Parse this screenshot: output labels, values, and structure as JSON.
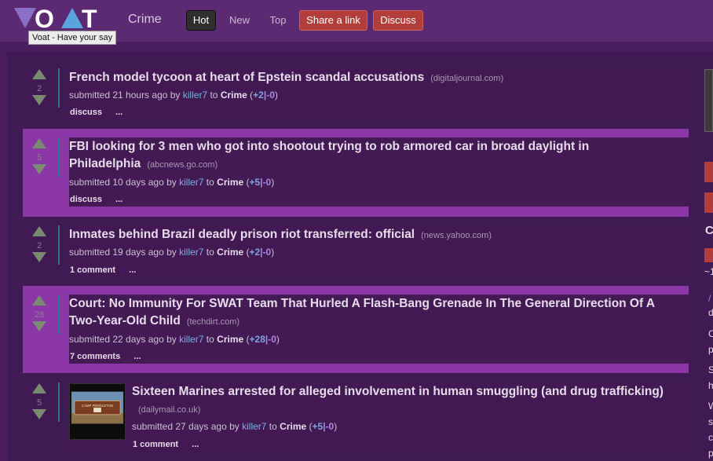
{
  "header": {
    "logo_text": "VOAT",
    "logo_tooltip": "Voat - Have your say",
    "subverse": "Crime",
    "tabs": [
      "Hot",
      "New",
      "Top"
    ],
    "share_label": "Share a link",
    "discuss_label": "Discuss",
    "colors": {
      "header_bg": "#5c2a73",
      "button_red": "#b23d3a",
      "logo_purple": "#8a6fc4",
      "logo_blue": "#5aa4de"
    }
  },
  "posts": [
    {
      "score": "2",
      "title": "French model tycoon at heart of Epstein scandal accusations",
      "domain": "(digitaljournal.com)",
      "submitted": "submitted 21 hours ago by",
      "user": "killer7",
      "to": "to",
      "subverse": "Crime",
      "open": "(",
      "up": "+2",
      "sep": "|",
      "down": "-0",
      "close": ")",
      "action": "discuss",
      "more": "...",
      "highlight": false
    },
    {
      "score": "5",
      "title": "FBI looking for 3 men who got into shootout trying to rob armored car in broad daylight in Philadelphia",
      "domain": "(abcnews.go.com)",
      "submitted": "submitted 10 days ago by",
      "user": "killer7",
      "to": "to",
      "subverse": "Crime",
      "open": "(",
      "up": "+5",
      "sep": "|",
      "down": "-0",
      "close": ")",
      "action": "discuss",
      "more": "...",
      "highlight": true
    },
    {
      "score": "2",
      "title": "Inmates behind Brazil deadly prison riot transferred: official",
      "domain": "(news.yahoo.com)",
      "submitted": "submitted 19 days ago by",
      "user": "killer7",
      "to": "to",
      "subverse": "Crime",
      "open": "(",
      "up": "+2",
      "sep": "|",
      "down": "-0",
      "close": ")",
      "action": "1 comment",
      "more": "...",
      "highlight": false
    },
    {
      "score": "28",
      "title": "Court: No Immunity For SWAT Team That Hurled A Flash-Bang Grenade In The General Direction Of A Two-Year-Old Child",
      "domain": "(techdirt.com)",
      "submitted": "submitted 22 days ago by",
      "user": "killer7",
      "to": "to",
      "subverse": "Crime",
      "open": "(",
      "up": "+28",
      "sep": "|",
      "down": "-0",
      "close": ")",
      "action": "7 comments",
      "more": "...",
      "highlight": true
    },
    {
      "score": "5",
      "title": "Sixteen Marines arrested for alleged involvement in human smuggling (and drug trafficking)",
      "domain": "(dailymail.co.uk)",
      "submitted": "submitted 27 days ago by",
      "user": "killer7",
      "to": "to",
      "subverse": "Crime",
      "open": "(",
      "up": "+5",
      "sep": "|",
      "down": "-0",
      "close": ")",
      "action": "1 comment",
      "more": "...",
      "highlight": false,
      "thumbnail_sign": "CAMP PENDLETON"
    }
  ],
  "sidebar": {
    "letters": [
      "C",
      "~1",
      "/",
      "d",
      "C",
      "p",
      "S",
      "h",
      "W",
      "s",
      "c",
      "p"
    ]
  }
}
